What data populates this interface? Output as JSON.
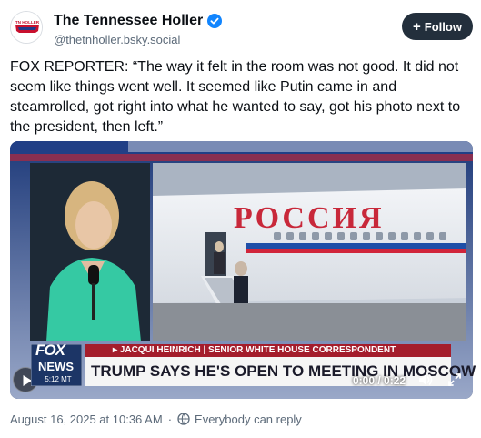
{
  "header": {
    "display_name": "The Tennessee Holler",
    "handle": "@thetnholler.bsky.social",
    "follow_label": "Follow",
    "avatar_text": "TN HOLLER",
    "verified_color": "#1185fe"
  },
  "post": {
    "text": "FOX REPORTER: “The way it felt in the room was not good. It did not seem like things went well. It seemed like Putin came in and steamrolled, got right into what he wanted to say, got his photo next to the president, then left.”"
  },
  "video": {
    "lower_third_label": "▸ JACQUI HEINRICH | SENIOR WHITE HOUSE CORRESPONDENT",
    "ticker_headline": "TRUMP SAYS HE'S OPEN TO MEETING IN MOSCOW",
    "network_logo_top": "FOX",
    "network_logo_bottom": "NEWS",
    "on_screen_clock": "5:12 MT",
    "plane_lettering": "РОССИЯ",
    "time_display": "0:00 / 0:22",
    "icons": [
      "play-icon",
      "volume-icon",
      "fullscreen-icon"
    ]
  },
  "meta": {
    "timestamp": "August 16, 2025 at 10:36 AM",
    "separator": "·",
    "reply_setting": "Everybody can reply"
  },
  "colors": {
    "follow_button": "#232f3c",
    "lower_third_red": "#a41d2c",
    "muted_text": "#5d6b7a"
  }
}
